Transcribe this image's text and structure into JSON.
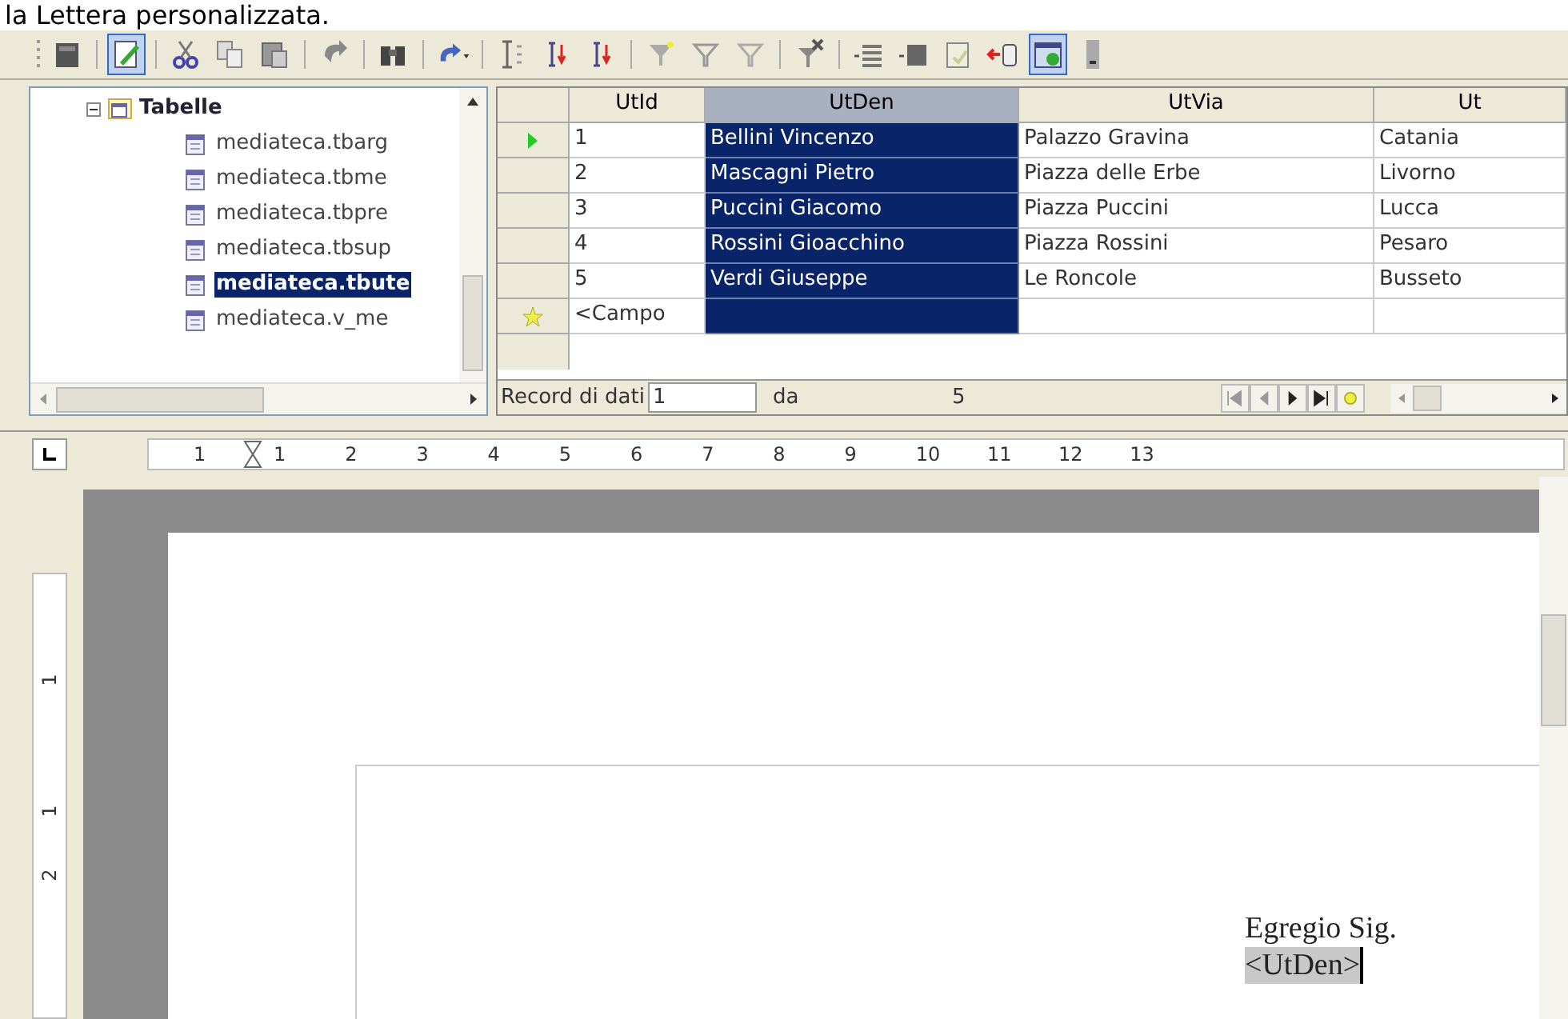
{
  "caption": "la Lettera personalizzata.",
  "toolbar": [
    {
      "pressed": false
    },
    {
      "pressed": true
    },
    {
      "pressed": false
    },
    {
      "pressed": false
    },
    {
      "pressed": false
    },
    {
      "pressed": false
    },
    {
      "pressed": false
    },
    {
      "pressed": false
    },
    {
      "pressed": false
    },
    {
      "pressed": false
    },
    {
      "pressed": false
    },
    {
      "pressed": false
    },
    {
      "pressed": false
    },
    {
      "pressed": false
    },
    {
      "pressed": false
    },
    {
      "pressed": false
    },
    {
      "pressed": false
    },
    {
      "pressed": false
    },
    {
      "pressed": false
    },
    {
      "pressed": true
    },
    {
      "pressed": false
    }
  ],
  "tree": {
    "label": "Tabelle",
    "expanded": true,
    "children": [
      {
        "label": "mediateca.tbarg",
        "selected": false
      },
      {
        "label": "mediateca.tbme",
        "selected": false
      },
      {
        "label": "mediateca.tbpre",
        "selected": false
      },
      {
        "label": "mediateca.tbsup",
        "selected": false
      },
      {
        "label": "mediateca.tbute",
        "selected": true
      },
      {
        "label": "mediateca.v_me",
        "selected": false
      }
    ]
  },
  "table": {
    "columns": [
      {
        "label": "UtId",
        "selected": false
      },
      {
        "label": "UtDen",
        "selected": true
      },
      {
        "label": "UtVia",
        "selected": false
      },
      {
        "label": "Ut",
        "selected": false
      }
    ],
    "rows": [
      {
        "current": true,
        "new": false,
        "cells": [
          "1",
          "Bellini Vincenzo",
          "Palazzo Gravina",
          "Catania"
        ]
      },
      {
        "current": false,
        "new": false,
        "cells": [
          "2",
          "Mascagni Pietro",
          "Piazza delle Erbe",
          "Livorno"
        ]
      },
      {
        "current": false,
        "new": false,
        "cells": [
          "3",
          "Puccini Giacomo",
          "Piazza Puccini",
          "Lucca"
        ]
      },
      {
        "current": false,
        "new": false,
        "cells": [
          "4",
          "Rossini Gioacchino",
          "Piazza Rossini",
          "Pesaro"
        ]
      },
      {
        "current": false,
        "new": false,
        "cells": [
          "5",
          "Verdi Giuseppe",
          "Le Roncole",
          "Busseto"
        ]
      },
      {
        "current": false,
        "new": true,
        "cells": [
          "<Campo",
          "",
          "",
          ""
        ]
      }
    ]
  },
  "navigator": {
    "label": "Record di dati",
    "value": "1",
    "of_label": "da",
    "total": "5"
  },
  "ruler": {
    "labels": [
      "1",
      "1",
      "2",
      "3",
      "4",
      "5",
      "6",
      "7",
      "8",
      "9",
      "10",
      "11",
      "12",
      "13"
    ]
  },
  "vertical_ruler": {
    "labels": [
      "1",
      "1",
      "2"
    ]
  },
  "document": {
    "lines": [
      "Egregio Sig.",
      "<UtDen>"
    ]
  }
}
